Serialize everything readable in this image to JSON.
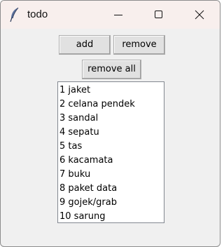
{
  "window": {
    "title": "todo",
    "icon": "feather-icon",
    "controls": [
      "minimize-icon",
      "maximize-icon",
      "close-icon"
    ]
  },
  "buttons": {
    "add": "add",
    "remove": "remove",
    "remove_all": "remove all"
  },
  "list": {
    "items": [
      "1 jaket",
      "2 celana pendek",
      "3 sandal",
      "4 sepatu",
      "5 tas",
      "6 kacamata",
      "7 buku",
      "8 paket data",
      "9 gojek/grab",
      "10 sarung"
    ]
  }
}
